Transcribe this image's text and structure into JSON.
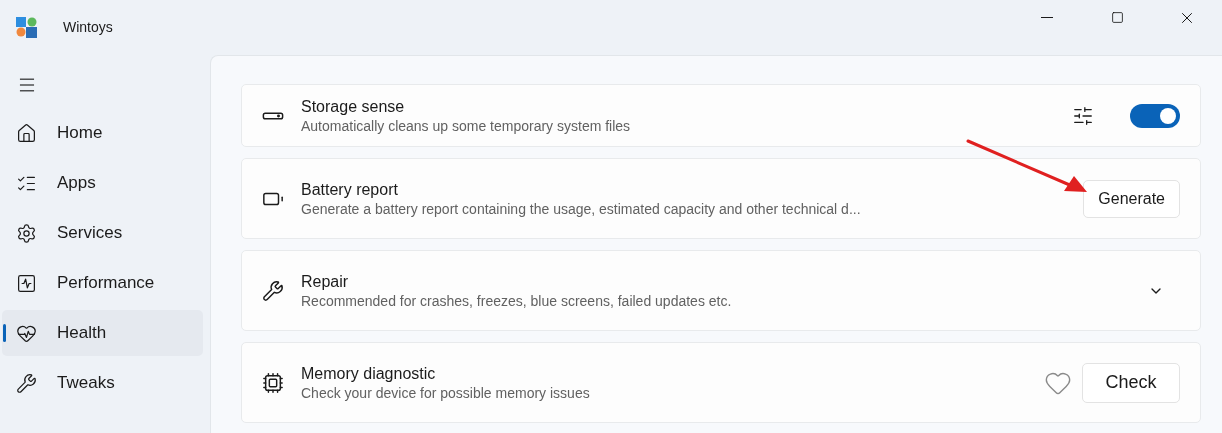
{
  "window": {
    "title": "Wintoys"
  },
  "sidebar": {
    "items": [
      {
        "label": "Home",
        "selected": false
      },
      {
        "label": "Apps",
        "selected": false
      },
      {
        "label": "Services",
        "selected": false
      },
      {
        "label": "Performance",
        "selected": false
      },
      {
        "label": "Health",
        "selected": true
      },
      {
        "label": "Tweaks",
        "selected": false
      }
    ]
  },
  "cards": [
    {
      "kind": "toggle",
      "title": "Storage sense",
      "description": "Automatically cleans up some temporary system files",
      "on": true
    },
    {
      "kind": "button",
      "title": "Battery report",
      "description": "Generate a battery report containing the usage, estimated capacity and other technical d...",
      "button": "Generate"
    },
    {
      "kind": "expander",
      "title": "Repair",
      "description": "Recommended for crashes, freezes, blue screens, failed updates etc.",
      "expanded": false
    },
    {
      "kind": "favorite_button",
      "title": "Memory diagnostic",
      "description": "Check your device for possible memory issues",
      "favorite": false,
      "button": "Check"
    }
  ]
}
